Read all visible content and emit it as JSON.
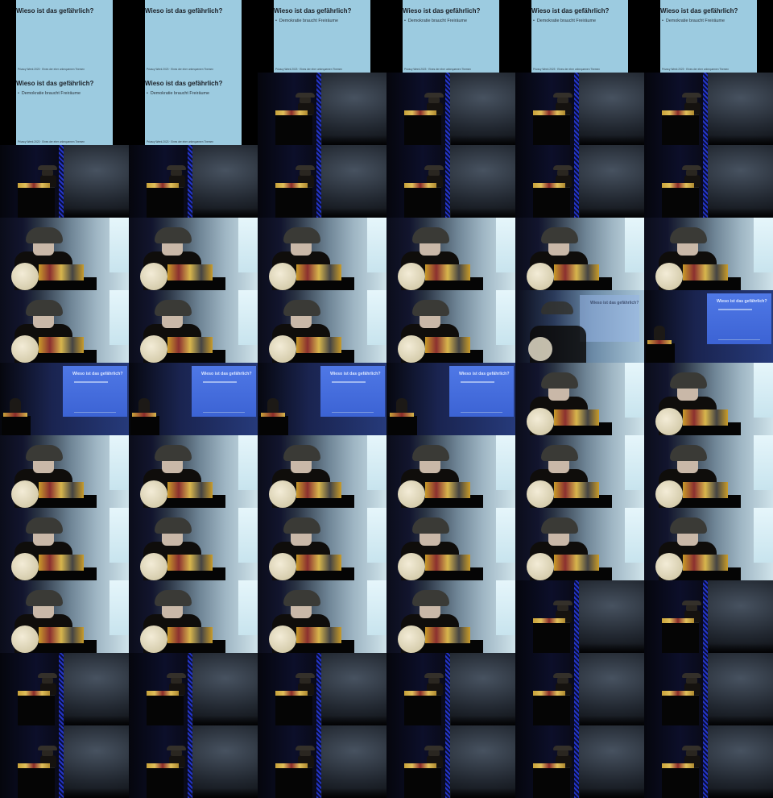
{
  "slide": {
    "title": "Wieso ist das gefährlich?",
    "bullet": "Demokratie braucht Freiräume",
    "footer": "Privacy Week 2023 · Eines der eher unbequemen Themen"
  },
  "tiles": [
    "slide-title",
    "slide-title",
    "slide-bullet",
    "slide-bullet",
    "slide-bullet",
    "slide-bullet",
    "slide-bullet",
    "slide-bullet",
    "stage-wide",
    "stage-wide",
    "stage-wide",
    "stage-wide",
    "stage-wide",
    "stage-wide",
    "stage-wide",
    "stage-wide",
    "stage-wide",
    "stage-wide",
    "speaker-closeup",
    "speaker-closeup",
    "speaker-closeup",
    "speaker-closeup",
    "speaker-closeup",
    "speaker-closeup",
    "speaker-closeup",
    "speaker-closeup",
    "speaker-closeup",
    "speaker-closeup",
    "transition",
    "projection",
    "projection",
    "projection",
    "projection",
    "projection",
    "speaker-closeup",
    "speaker-closeup",
    "speaker-closeup",
    "speaker-closeup",
    "speaker-closeup",
    "speaker-closeup",
    "speaker-closeup",
    "speaker-closeup",
    "speaker-closeup",
    "speaker-closeup",
    "speaker-closeup",
    "speaker-closeup",
    "speaker-closeup",
    "speaker-closeup",
    "speaker-closeup",
    "speaker-closeup",
    "speaker-closeup",
    "speaker-closeup",
    "stage-wide",
    "stage-wide",
    "stage-wide",
    "stage-wide",
    "stage-wide",
    "stage-wide",
    "stage-wide",
    "stage-wide",
    "stage-wide",
    "stage-wide",
    "stage-wide",
    "stage-wide",
    "stage-wide",
    "stage-wide"
  ]
}
